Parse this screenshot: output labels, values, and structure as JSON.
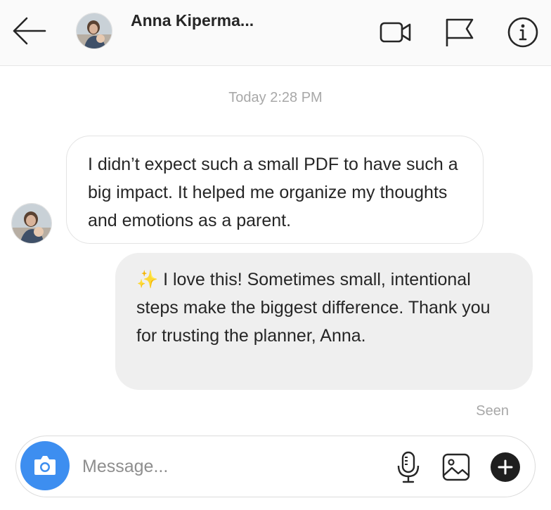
{
  "header": {
    "contact_name": "Anna Kiperma...",
    "icons": {
      "back": "arrow-left-icon",
      "video": "video-camera-icon",
      "flag": "flag-icon",
      "info": "info-icon"
    }
  },
  "conversation": {
    "timestamp": "Today 2:28 PM",
    "messages": [
      {
        "direction": "incoming",
        "text": "I didn’t expect such a small PDF to have such a big impact. It helped me organize my thoughts and emotions as a parent."
      },
      {
        "direction": "outgoing",
        "emoji": "✨",
        "text": " I love this! Sometimes small, intentional steps make the biggest difference. Thank you for trusting the planner, Anna."
      }
    ],
    "status": "Seen"
  },
  "composer": {
    "placeholder": "Message...",
    "value": "",
    "icons": {
      "camera": "camera-icon",
      "mic": "microphone-icon",
      "gallery": "image-icon",
      "plus": "plus-icon"
    }
  },
  "colors": {
    "accent": "#3d8ef0",
    "header_bg": "#fafafa",
    "outgoing_bubble": "#efefef",
    "muted_text": "#a8a8a8"
  }
}
